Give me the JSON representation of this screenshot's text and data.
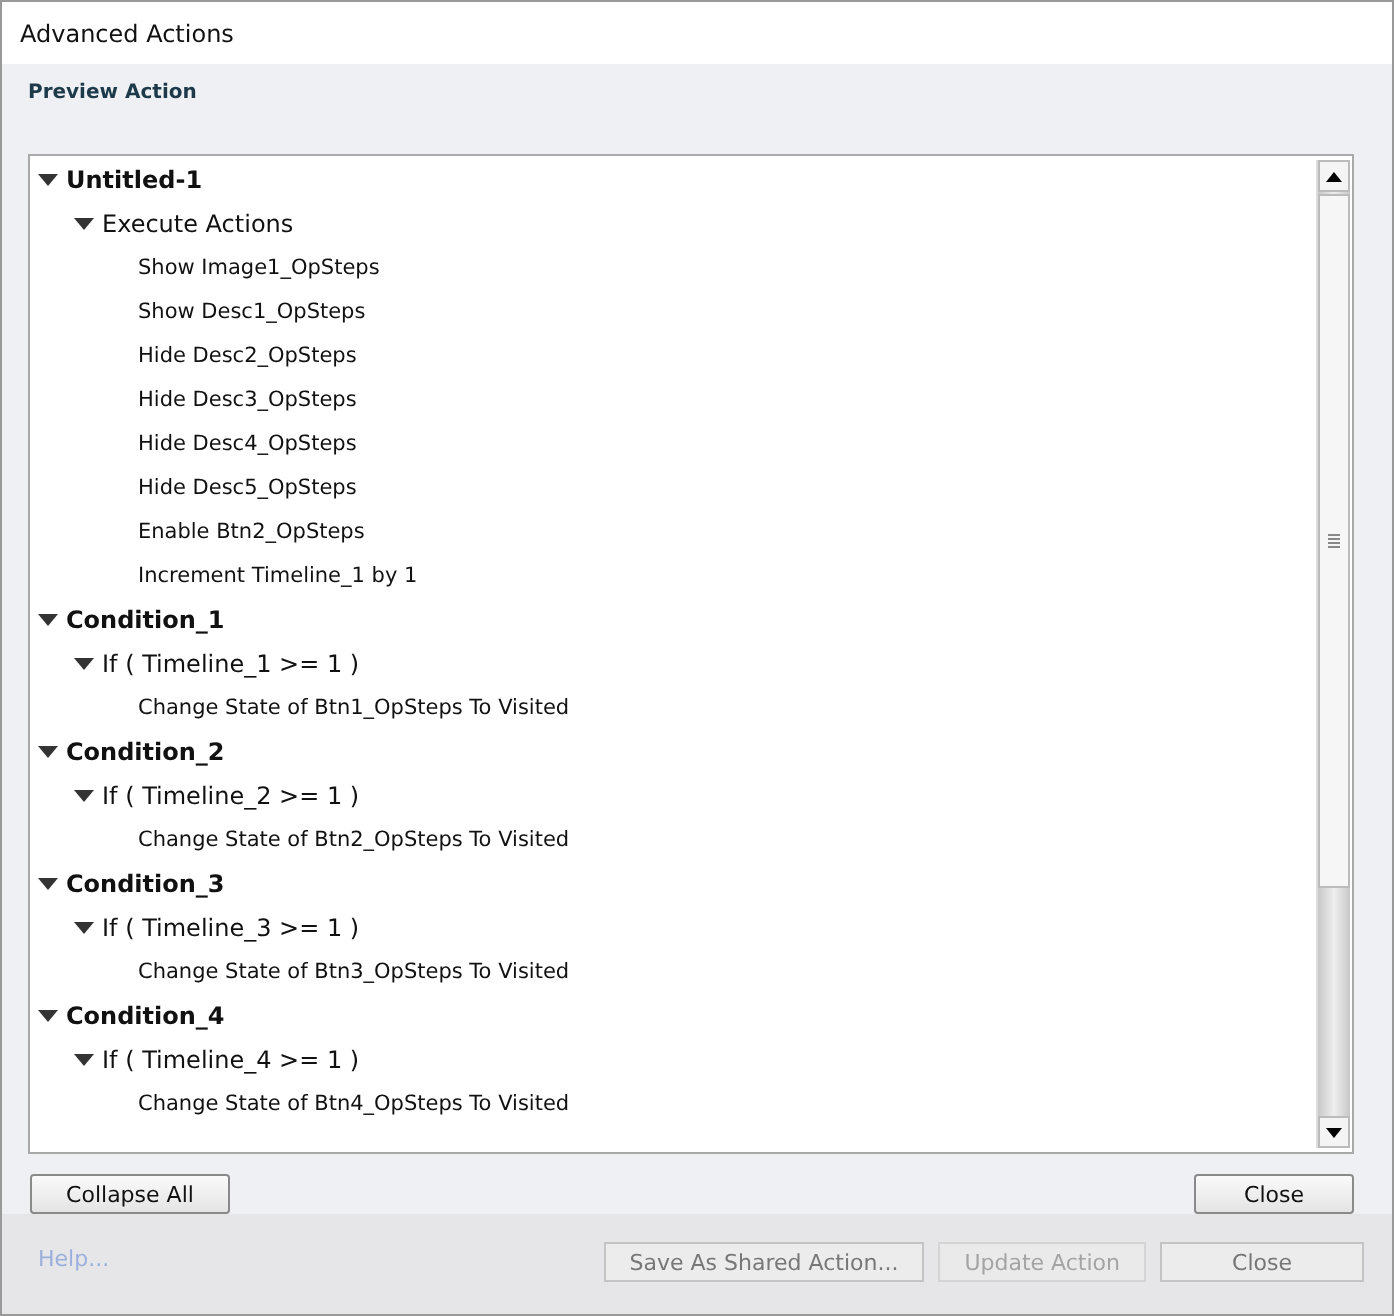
{
  "window": {
    "title": "Advanced Actions"
  },
  "section_title": "Preview Action",
  "tree": [
    {
      "label": "Untitled-1",
      "expanded": true,
      "children": [
        {
          "label": "Execute Actions",
          "expanded": true,
          "children": [
            {
              "label": "Show Image1_OpSteps"
            },
            {
              "label": "Show Desc1_OpSteps"
            },
            {
              "label": "Hide Desc2_OpSteps"
            },
            {
              "label": "Hide Desc3_OpSteps"
            },
            {
              "label": "Hide Desc4_OpSteps"
            },
            {
              "label": "Hide Desc5_OpSteps"
            },
            {
              "label": "Enable Btn2_OpSteps"
            },
            {
              "label": "Increment Timeline_1 by 1"
            }
          ]
        }
      ]
    },
    {
      "label": "Condition_1",
      "expanded": true,
      "children": [
        {
          "label": "If ( Timeline_1 >= 1  )",
          "expanded": true,
          "children": [
            {
              "label": "Change State of Btn1_OpSteps To Visited"
            }
          ]
        }
      ]
    },
    {
      "label": "Condition_2",
      "expanded": true,
      "children": [
        {
          "label": "If ( Timeline_2 >= 1  )",
          "expanded": true,
          "children": [
            {
              "label": "Change State of Btn2_OpSteps To Visited"
            }
          ]
        }
      ]
    },
    {
      "label": "Condition_3",
      "expanded": true,
      "children": [
        {
          "label": "If ( Timeline_3 >= 1  )",
          "expanded": true,
          "children": [
            {
              "label": "Change State of Btn3_OpSteps To Visited"
            }
          ]
        }
      ]
    },
    {
      "label": "Condition_4",
      "expanded": true,
      "children": [
        {
          "label": "If ( Timeline_4 >= 1  )",
          "expanded": true,
          "children": [
            {
              "label": "Change State of Btn4_OpSteps To Visited"
            }
          ]
        }
      ]
    }
  ],
  "preview_buttons": [
    {
      "label": "Collapse All"
    },
    {
      "label": "Close"
    }
  ],
  "footer": {
    "help_link": "Help...",
    "buttons": [
      {
        "label": "Save As Shared Action...",
        "disabled": false
      },
      {
        "label": "Update Action",
        "disabled": true
      },
      {
        "label": "Close",
        "disabled": false
      }
    ]
  }
}
